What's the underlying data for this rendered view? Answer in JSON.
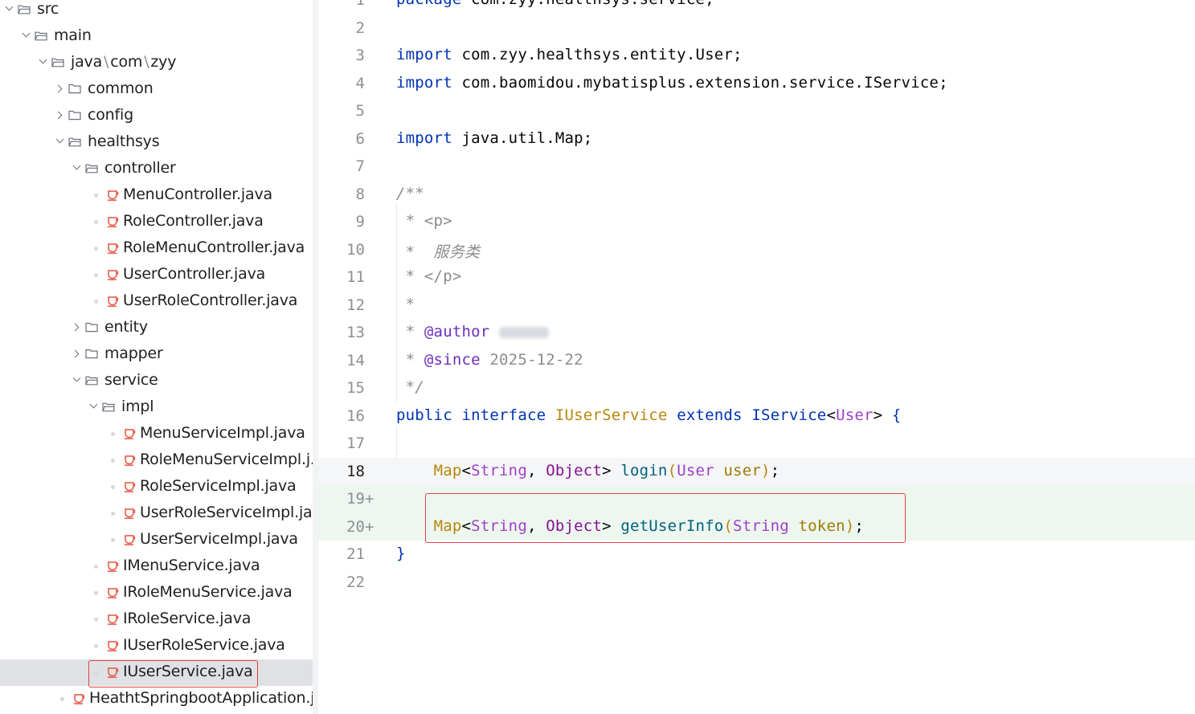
{
  "tree": {
    "items": [
      {
        "label": "src",
        "type": "folder-open"
      },
      {
        "label": "main",
        "type": "folder-open"
      },
      {
        "label_parts": [
          "java",
          "com",
          "zyy"
        ],
        "type": "folder-open"
      },
      {
        "label": "common",
        "type": "folder-closed"
      },
      {
        "label": "config",
        "type": "folder-closed"
      },
      {
        "label": "healthsys",
        "type": "folder-open"
      },
      {
        "label": "controller",
        "type": "folder-open"
      },
      {
        "label": "MenuController.java",
        "type": "java-file"
      },
      {
        "label": "RoleController.java",
        "type": "java-file"
      },
      {
        "label": "RoleMenuController.java",
        "type": "java-file"
      },
      {
        "label": "UserController.java",
        "type": "java-file"
      },
      {
        "label": "UserRoleController.java",
        "type": "java-file"
      },
      {
        "label": "entity",
        "type": "folder-closed"
      },
      {
        "label": "mapper",
        "type": "folder-closed"
      },
      {
        "label": "service",
        "type": "folder-open"
      },
      {
        "label": "impl",
        "type": "folder-open"
      },
      {
        "label": "MenuServiceImpl.java",
        "type": "java-file"
      },
      {
        "label": "RoleMenuServiceImpl.j...",
        "type": "java-file"
      },
      {
        "label": "RoleServiceImpl.java",
        "type": "java-file"
      },
      {
        "label": "UserRoleServiceImpl.java",
        "type": "java-file"
      },
      {
        "label": "UserServiceImpl.java",
        "type": "java-file"
      },
      {
        "label": "IMenuService.java",
        "type": "java-file"
      },
      {
        "label": "IRoleMenuService.java",
        "type": "java-file"
      },
      {
        "label": "IRoleService.java",
        "type": "java-file"
      },
      {
        "label": "IUserRoleService.java",
        "type": "java-file"
      },
      {
        "label": "IUserService.java",
        "type": "java-file",
        "selected": true
      },
      {
        "label": "HeathtSpringbootApplication.j...",
        "type": "java-file"
      }
    ],
    "path_separator": "\\"
  },
  "editor": {
    "current_line": 18,
    "lines": [
      {
        "n": "1",
        "tokens": [
          [
            "kw",
            "package "
          ],
          [
            "plain",
            "com.zyy.healthsys.service;"
          ]
        ]
      },
      {
        "n": "2",
        "tokens": []
      },
      {
        "n": "3",
        "tokens": [
          [
            "kw",
            "import "
          ],
          [
            "plain",
            "com.zyy.healthsys.entity.User;"
          ]
        ]
      },
      {
        "n": "4",
        "tokens": [
          [
            "kw",
            "import "
          ],
          [
            "plain",
            "com.baomidou.mybatisplus.extension.service.IService;"
          ]
        ]
      },
      {
        "n": "5",
        "tokens": []
      },
      {
        "n": "6",
        "tokens": [
          [
            "kw",
            "import "
          ],
          [
            "plain",
            "java.util.Map;"
          ]
        ]
      },
      {
        "n": "7",
        "tokens": []
      },
      {
        "n": "8",
        "tokens": [
          [
            "cm",
            "/**"
          ]
        ]
      },
      {
        "n": "9",
        "tokens": [
          [
            "cm",
            " * "
          ],
          [
            "tag",
            "<p>"
          ]
        ]
      },
      {
        "n": "10",
        "tokens": [
          [
            "cm",
            " *  服务类"
          ]
        ]
      },
      {
        "n": "11",
        "tokens": [
          [
            "cm",
            " * "
          ],
          [
            "tag",
            "</p>"
          ]
        ]
      },
      {
        "n": "12",
        "tokens": [
          [
            "cm",
            " *"
          ]
        ]
      },
      {
        "n": "13",
        "tokens": [
          [
            "cm",
            " * "
          ],
          [
            "doc",
            "@author "
          ],
          [
            "blur",
            ""
          ]
        ]
      },
      {
        "n": "14",
        "tokens": [
          [
            "cm",
            " * "
          ],
          [
            "doc",
            "@since "
          ],
          [
            "tag",
            "2025-12-22"
          ]
        ]
      },
      {
        "n": "15",
        "tokens": [
          [
            "cm",
            " */"
          ]
        ]
      },
      {
        "n": "16",
        "tokens": [
          [
            "kw",
            "public "
          ],
          [
            "kw",
            "interface "
          ],
          [
            "iface",
            "IUserService "
          ],
          [
            "kw",
            "extends "
          ],
          [
            "cls",
            "IService"
          ],
          [
            "plain",
            "<"
          ],
          [
            "gen",
            "User"
          ],
          [
            "plain",
            "> "
          ],
          [
            "brace",
            "{"
          ]
        ]
      },
      {
        "n": "17",
        "tokens": []
      },
      {
        "n": "18",
        "tokens": [
          [
            "plain",
            "    "
          ],
          [
            "iface",
            "Map"
          ],
          [
            "plain",
            "<"
          ],
          [
            "gen",
            "String"
          ],
          [
            "plain",
            ", "
          ],
          [
            "ty",
            "Object"
          ],
          [
            "plain",
            "> "
          ],
          [
            "fn",
            "login"
          ],
          [
            "iface",
            "("
          ],
          [
            "gen",
            "User "
          ],
          [
            "par",
            "user"
          ],
          [
            "iface",
            ")"
          ],
          [
            "plain",
            ";"
          ]
        ]
      },
      {
        "n": "19",
        "mark": "+",
        "tokens": []
      },
      {
        "n": "20",
        "mark": "+",
        "tokens": [
          [
            "plain",
            "    "
          ],
          [
            "iface",
            "Map"
          ],
          [
            "plain",
            "<"
          ],
          [
            "gen",
            "String"
          ],
          [
            "plain",
            ", "
          ],
          [
            "ty",
            "Object"
          ],
          [
            "plain",
            "> "
          ],
          [
            "fn",
            "getUserInfo"
          ],
          [
            "iface",
            "("
          ],
          [
            "gen",
            "String "
          ],
          [
            "par",
            "token"
          ],
          [
            "iface",
            ")"
          ],
          [
            "plain",
            ";"
          ]
        ]
      },
      {
        "n": "21",
        "tokens": [
          [
            "brace",
            "}"
          ]
        ]
      },
      {
        "n": "22",
        "tokens": []
      }
    ]
  },
  "colors": {
    "accent_red": "#e0443e",
    "keyword": "#0033b3",
    "comment": "#8c8c8c",
    "java_icon": "#e8523f"
  }
}
